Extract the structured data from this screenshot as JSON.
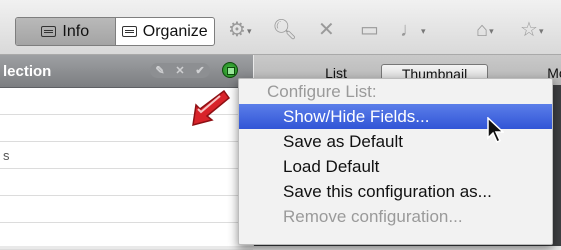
{
  "toolbar": {
    "info_label": "Info",
    "organize_label": "Organize",
    "icons": [
      "gear-icon",
      "page-search-icon",
      "delete-x-icon",
      "preview-icon",
      "microphone-icon",
      "home-icon",
      "star-home-icon"
    ]
  },
  "left_panel": {
    "header_label": "lection",
    "header_controls": [
      "✎",
      "✕",
      "✔"
    ],
    "rows": [
      "",
      "",
      "s",
      "",
      "",
      ""
    ]
  },
  "tabs": [
    "List",
    "Thumbnail",
    "Mo"
  ],
  "menu": {
    "header": "Configure List:",
    "items": [
      {
        "label": "Show/Hide Fields...",
        "state": "highlighted"
      },
      {
        "label": "Save as Default",
        "state": "enabled"
      },
      {
        "label": "Load Default",
        "state": "enabled"
      },
      {
        "label": "Save this configuration as...",
        "state": "enabled"
      },
      {
        "label": "Remove configuration...",
        "state": "disabled"
      }
    ]
  },
  "colors": {
    "highlight": "#3d62dd",
    "green_button": "#2e9b2b",
    "arrow": "#d8232a"
  }
}
